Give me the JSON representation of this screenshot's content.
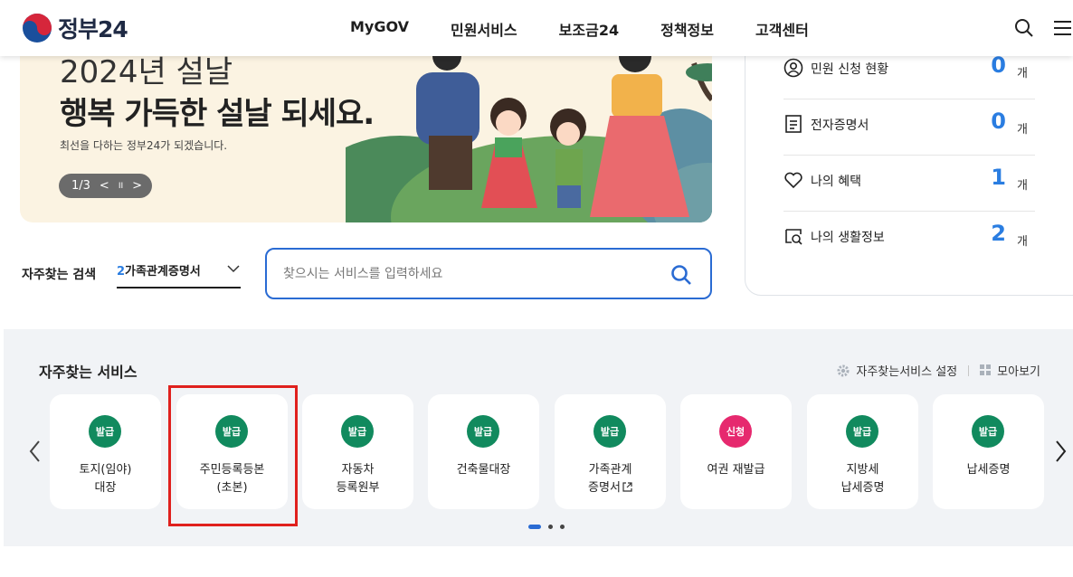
{
  "header": {
    "logo_text": "정부24",
    "nav": [
      "MyGOV",
      "민원서비스",
      "보조금24",
      "정책정보",
      "고객센터"
    ]
  },
  "banner": {
    "line1": "2024년 설날",
    "line2": "행복 가득한 설날 되세요.",
    "sub": "최선을 다하는 정부24가 되겠습니다.",
    "pager_text": "1/3",
    "prev_glyph": "<",
    "pause_glyph": "II",
    "next_glyph": ">"
  },
  "mygov": {
    "items": [
      {
        "label": "민원 신청 현황",
        "count": "0",
        "unit": "개",
        "icon": "person-circle-icon"
      },
      {
        "label": "전자증명서",
        "count": "0",
        "unit": "개",
        "icon": "document-icon"
      },
      {
        "label": "나의 혜택",
        "count": "1",
        "unit": "개",
        "icon": "heart-icon"
      },
      {
        "label": "나의 생활정보",
        "count": "2",
        "unit": "개",
        "icon": "search-doc-icon"
      }
    ]
  },
  "search": {
    "label": "자주찾는 검색",
    "select_num": "2",
    "select_value": "가족관계증명서",
    "placeholder": "찾으시는 서비스를 입력하세요"
  },
  "services": {
    "title": "자주찾는 서비스",
    "settings_label": "자주찾는서비스 설정",
    "collect_label": "모아보기",
    "items": [
      {
        "badge": "발급",
        "label": "토지(임야)\n대장"
      },
      {
        "badge": "발급",
        "label": "주민등록등본\n(초본)"
      },
      {
        "badge": "발급",
        "label": "자동차\n등록원부"
      },
      {
        "badge": "발급",
        "label": "건축물대장"
      },
      {
        "badge": "발급",
        "label": "가족관계\n증명서"
      },
      {
        "badge": "신청",
        "label": "여권 재발급"
      },
      {
        "badge": "발급",
        "label": "지방세\n납세증명"
      },
      {
        "badge": "발급",
        "label": "납세증명"
      }
    ]
  },
  "colors": {
    "accent": "#2a6bd3",
    "count": "#2a7de1",
    "badge_green": "#118a5e",
    "badge_pink": "#e6296e",
    "highlight": "#e0201d"
  }
}
